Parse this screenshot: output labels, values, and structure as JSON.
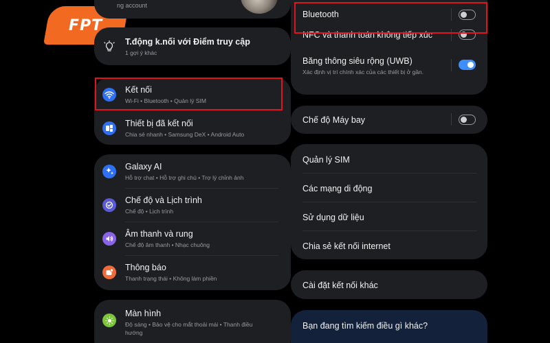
{
  "logo": {
    "text": "FPT"
  },
  "left": {
    "account_partial": "ng account",
    "suggestion": {
      "title": "T.động k.nối với Điểm truy cập",
      "sub": "1 gợi ý khác"
    },
    "connections": {
      "title": "Kết nối",
      "sub": "Wi-Fi • Bluetooth • Quản lý SIM",
      "icon": "wifi-icon"
    },
    "connected_devices": {
      "title": "Thiết bị đã kết nối",
      "sub": "Chia sẻ nhanh • Samsung DeX • Android Auto",
      "icon": "devices-icon"
    },
    "galaxy_ai": {
      "title": "Galaxy AI",
      "sub": "Hỗ trợ chat • Hỗ trợ ghi chú • Trợ lý chỉnh ảnh",
      "icon": "sparkle-icon"
    },
    "modes": {
      "title": "Chế độ và Lịch trình",
      "sub": "Chế độ • Lịch trình",
      "icon": "check-circle-icon"
    },
    "sound": {
      "title": "Âm thanh và rung",
      "sub": "Chế độ âm thanh • Nhạc chuông",
      "icon": "volume-icon"
    },
    "notifications": {
      "title": "Thông báo",
      "sub": "Thanh trạng thái • Không làm phiền",
      "icon": "notification-icon"
    },
    "display": {
      "title": "Màn hình",
      "sub": "Độ sáng • Bảo vệ cho mắt thoải mái • Thanh điều hướng",
      "icon": "brightness-icon"
    }
  },
  "right": {
    "bluetooth": {
      "title": "Bluetooth",
      "on": false
    },
    "nfc": {
      "title": "NFC và thanh toán không tiếp xúc",
      "on": false
    },
    "uwb": {
      "title": "Băng thông siêu rộng (UWB)",
      "sub": "Xác định vị trí chính xác của các thiết bị ở gần.",
      "on": true
    },
    "airplane": {
      "title": "Chế độ Máy bay",
      "on": false
    },
    "sim_manager": "Quản lý SIM",
    "mobile_networks": "Các mạng di động",
    "data_usage": "Sử dụng dữ liệu",
    "hotspot": "Chia sẻ kết nối internet",
    "more_settings": "Cài đặt kết nối khác",
    "looking_for": "Bạn đang tìm kiếm điều gì khác?"
  },
  "colors": {
    "accent_toggle": "#3e8eff",
    "highlight_box": "#e0141e",
    "logo_orange": "#f26a21"
  }
}
